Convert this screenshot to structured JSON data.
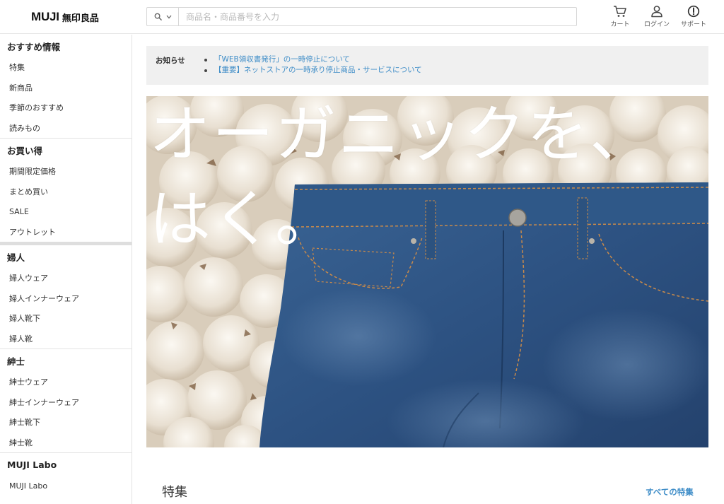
{
  "header": {
    "logo_latin": "MUJI",
    "logo_kanji": "無印良品",
    "search_placeholder": "商品名・商品番号を入力",
    "cart_label": "カート",
    "login_label": "ログイン",
    "support_label": "サポート"
  },
  "sidebar": {
    "sections": [
      {
        "title": "おすすめ情報",
        "items": [
          "特集",
          "新商品",
          "季節のおすすめ",
          "読みもの"
        ]
      },
      {
        "title": "お買い得",
        "items": [
          "期間限定価格",
          "まとめ買い",
          "SALE",
          "アウトレット"
        ]
      },
      {
        "title": "婦人",
        "items": [
          "婦人ウェア",
          "婦人インナーウェア",
          "婦人靴下",
          "婦人靴"
        ]
      },
      {
        "title": "紳士",
        "items": [
          "紳士ウェア",
          "紳士インナーウェア",
          "紳士靴下",
          "紳士靴"
        ]
      },
      {
        "title": "MUJI Labo",
        "items": [
          "MUJI Labo"
        ]
      }
    ]
  },
  "notice": {
    "label": "お知らせ",
    "items": [
      "「WEB領収書発行」の一時停止について",
      "【重要】ネットストアの一時承り停止商品・サービスについて"
    ]
  },
  "hero": {
    "line1": "オーガニックを、",
    "line2": "はく。"
  },
  "feature": {
    "title": "特集",
    "see_all": "すべての特集"
  },
  "colors": {
    "link": "#3d8cc7",
    "notice_bg": "#f0f0f0",
    "denim": "#2f5585",
    "cotton": "#e9e0d2"
  }
}
